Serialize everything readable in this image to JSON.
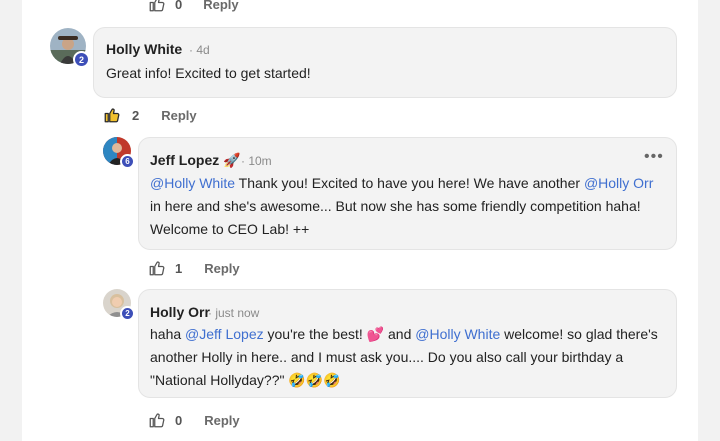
{
  "top_actions": {
    "like_count": "0",
    "reply_label": "Reply"
  },
  "comments": [
    {
      "author": "Holly White",
      "time": "· 4d",
      "badge": "2",
      "text": "Great info! Excited to get started!",
      "like_count": "2",
      "reply_label": "Reply",
      "liked": true
    },
    {
      "author": "Jeff Lopez",
      "author_emoji": "🚀",
      "time": "· 10m",
      "badge": "6",
      "mention": "@Holly White",
      "text_1": " Thank you! Excited to have you here! We have another ",
      "mention_2": "@Holly Orr",
      "text_2": " in here and she's awesome... But now she has some friendly competition haha! Welcome to CEO Lab! ++",
      "like_count": "1",
      "reply_label": "Reply",
      "menu_icon": "more-horizontal-icon"
    },
    {
      "author": "Holly Orr",
      "time": "· just now",
      "badge": "2",
      "text_1": "haha ",
      "mention": "@Jeff Lopez",
      "text_2": " you're the best! 💕 and ",
      "mention_2": "@Holly White",
      "text_3": " welcome! so glad there's another Holly in here.. and I must ask you.... Do you also call your birthday a \"National Hollyday??\" 🤣🤣🤣",
      "like_count": "0",
      "reply_label": "Reply"
    }
  ],
  "colors": {
    "mention": "#3f6fd0",
    "badge": "#3d4fb8",
    "like_active": "#2b2b2b"
  }
}
